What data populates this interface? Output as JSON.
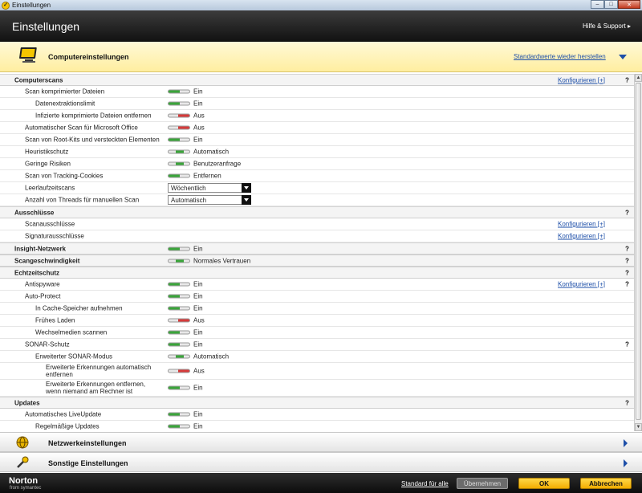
{
  "window": {
    "title": "Einstellungen",
    "minimize": "–",
    "maximize": "□",
    "close": "✕"
  },
  "header": {
    "title": "Einstellungen",
    "help": "Hilfe & Support ▸"
  },
  "section": {
    "title": "Computereinstellungen",
    "restore_link": "Standardwerte wieder herstellen"
  },
  "common": {
    "configure": "Konfigurieren [+]",
    "help_q": "?"
  },
  "rows": {
    "computerscans": "Computerscans",
    "scan_compressed": {
      "label": "Scan komprimierter Dateien",
      "value": "Ein"
    },
    "extraction_limit": {
      "label": "Datenextraktionslimit",
      "value": "Ein"
    },
    "remove_infected": {
      "label": "Infizierte komprimierte Dateien entfernen",
      "value": "Aus"
    },
    "office_scan": {
      "label": "Automatischer Scan für Microsoft Office",
      "value": "Aus"
    },
    "rootkits": {
      "label": "Scan von Root-Kits und versteckten Elementen",
      "value": "Ein"
    },
    "heuristic": {
      "label": "Heuristikschutz",
      "value": "Automatisch"
    },
    "low_risks": {
      "label": "Geringe Risiken",
      "value": "Benutzeranfrage"
    },
    "tracking_cookies": {
      "label": "Scan von Tracking-Cookies",
      "value": "Entfernen"
    },
    "idle_scans": {
      "label": "Leerlaufzeitscans",
      "value": "Wöchentlich"
    },
    "threads": {
      "label": "Anzahl von Threads für manuellen Scan",
      "value": "Automatisch"
    },
    "exclusions": "Ausschlüsse",
    "scan_exclusions": "Scanausschlüsse",
    "signature_exclusions": "Signaturausschlüsse",
    "insight": {
      "label": "Insight-Netzwerk",
      "value": "Ein"
    },
    "scan_speed": {
      "label": "Scangeschwindigkeit",
      "value": "Normales Vertrauen"
    },
    "realtime": "Echtzeitschutz",
    "antispyware": {
      "label": "Antispyware",
      "value": "Ein"
    },
    "autoprotect": {
      "label": "Auto-Protect",
      "value": "Ein"
    },
    "cache": {
      "label": "In Cache-Speicher aufnehmen",
      "value": "Ein"
    },
    "early_load": {
      "label": "Frühes Laden",
      "value": "Aus"
    },
    "removable": {
      "label": "Wechselmedien scannen",
      "value": "Ein"
    },
    "sonar": {
      "label": "SONAR-Schutz",
      "value": "Ein"
    },
    "sonar_adv": {
      "label": "Erweiterter SONAR-Modus",
      "value": "Automatisch"
    },
    "adv_auto_remove": {
      "label": "Erweiterte Erkennungen automatisch entfernen",
      "value": "Aus"
    },
    "adv_remove_away": {
      "label": "Erweiterte Erkennungen entfernen, wenn niemand am Rechner ist",
      "value": "Ein"
    },
    "updates": "Updates",
    "auto_liveupdate": {
      "label": "Automatisches LiveUpdate",
      "value": "Ein"
    },
    "regular_updates": {
      "label": "Regelmäßige Updates",
      "value": "Ein"
    }
  },
  "bars": {
    "network": "Netzwerkeinstellungen",
    "other": "Sonstige Einstellungen"
  },
  "footer": {
    "logo": "Norton",
    "logo_sub": "from symantec",
    "standard_all": "Standard für alle",
    "apply": "Übernehmen",
    "ok": "OK",
    "cancel": "Abbrechen"
  }
}
